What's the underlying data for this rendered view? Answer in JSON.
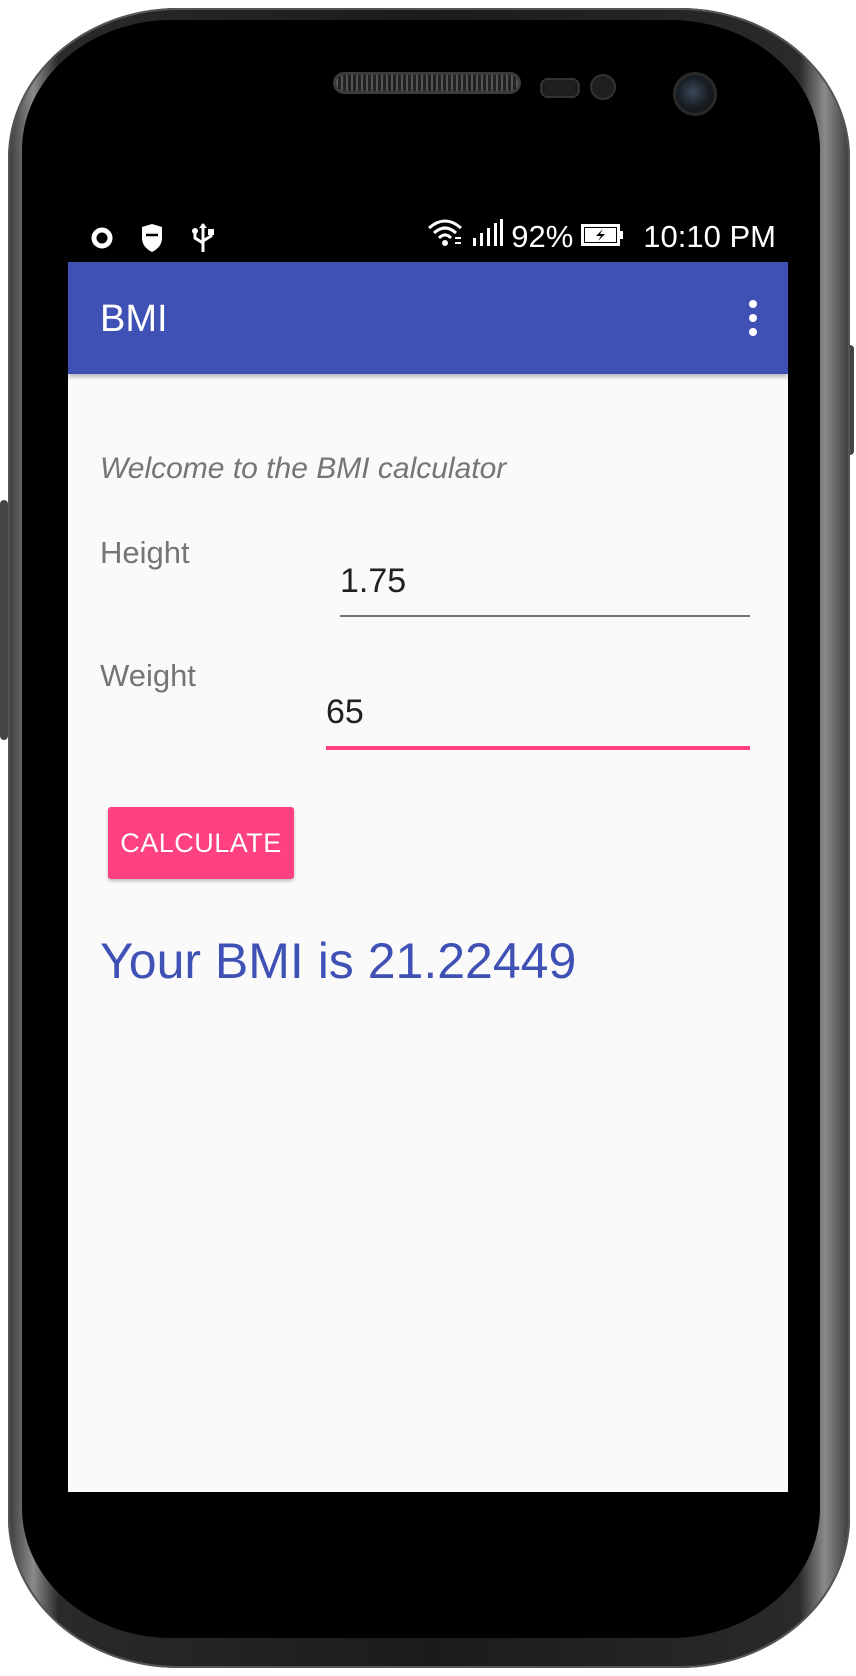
{
  "status_bar": {
    "battery_percent": "92%",
    "time": "10:10 PM",
    "icons_left": [
      "sync-icon",
      "shield-icon",
      "usb-icon"
    ],
    "icons_right": [
      "wifi-icon",
      "signal-icon",
      "battery-charging-icon"
    ]
  },
  "app_bar": {
    "title": "BMI",
    "menu_icon": "overflow-menu-icon"
  },
  "main": {
    "welcome": "Welcome to the BMI calculator",
    "height_label": "Height",
    "height_value": "1.75",
    "weight_label": "Weight",
    "weight_value": "65",
    "calculate_label": "CALCULATE",
    "result": "Your BMI is 21.22449"
  },
  "colors": {
    "primary": "#3f51b5",
    "accent": "#ff4081",
    "background": "#fafafa",
    "secondary_text": "#757575"
  }
}
